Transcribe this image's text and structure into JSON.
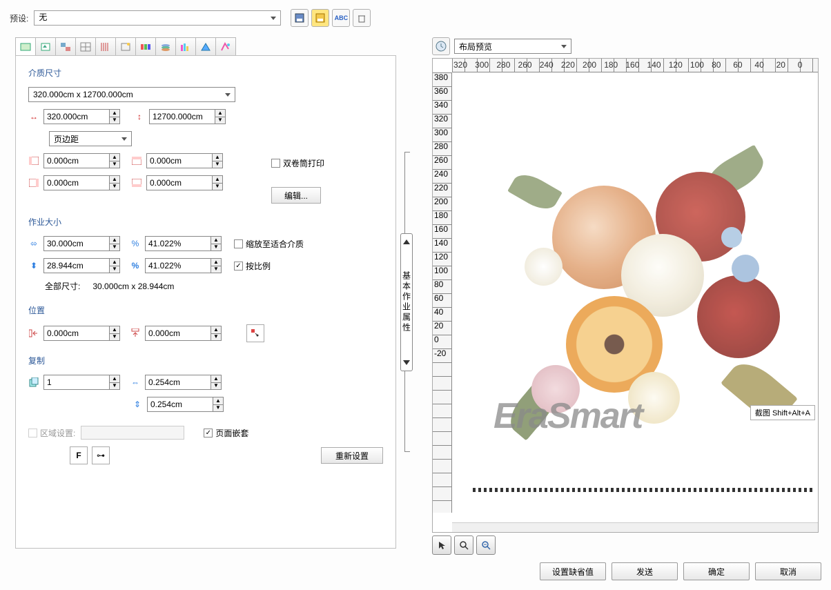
{
  "preset": {
    "label": "预设:",
    "value": "无"
  },
  "preview_dropdown": "布局预览",
  "sections": {
    "media": "介质尺寸",
    "job": "作业大小",
    "position": "位置",
    "copies": "复制"
  },
  "media": {
    "size_combo": "320.000cm x 12700.000cm",
    "width": "320.000cm",
    "height": "12700.000cm",
    "margin_combo": "页边距",
    "m_left": "0.000cm",
    "m_right": "0.000cm",
    "m_top": "0.000cm",
    "m_bottom": "0.000cm",
    "dual_roll": "双卷筒打印",
    "edit_btn": "编辑..."
  },
  "job": {
    "w": "30.000cm",
    "w_pct": "41.022%",
    "h": "28.944cm",
    "h_pct": "41.022%",
    "fit_media": "缩放至适合介质",
    "proportional": "按比例",
    "full_lbl": "全部尺寸:",
    "full_val": "30.000cm x 28.944cm"
  },
  "pos": {
    "x": "0.000cm",
    "y": "0.000cm"
  },
  "copies": {
    "count": "1",
    "hgap": "0.254cm",
    "vgap": "0.254cm"
  },
  "region": {
    "label": "区域设置:",
    "nest": "页面嵌套",
    "reset": "重新设置",
    "f_btn": "F"
  },
  "vert_label": "基本作业属性",
  "ruler_h": [
    "320",
    "300",
    "280",
    "260",
    "240",
    "220",
    "200",
    "180",
    "160",
    "140",
    "120",
    "100",
    "80",
    "60",
    "40",
    "20",
    "0"
  ],
  "ruler_v": [
    "380",
    "360",
    "340",
    "320",
    "300",
    "280",
    "260",
    "240",
    "220",
    "200",
    "180",
    "160",
    "140",
    "120",
    "100",
    "80",
    "60",
    "40",
    "20",
    "0",
    "-20"
  ],
  "watermark": "EraSmart",
  "tooltip": "截图 Shift+Alt+A",
  "buttons": {
    "default": "设置缺省值",
    "send": "发送",
    "ok": "确定",
    "cancel": "取消"
  }
}
